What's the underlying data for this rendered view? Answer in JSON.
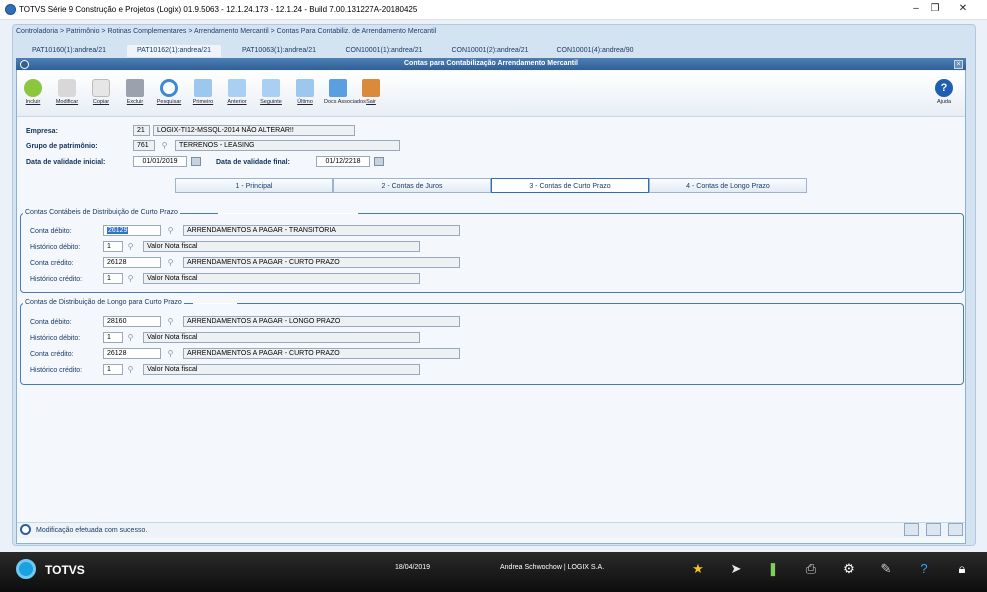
{
  "window": {
    "title": "TOTVS Série 9 Construção e Projetos (Logix) 01.9.5063  -  12.1.24.173 - 12.1.24 - Build 7.00.131227A-20180425"
  },
  "breadcrumb": "Controladoria > Patrimônio > Rotinas Complementares > Arrendamento Mercantil > Contas Para Contabiliz. de Arrendamento Mercantil",
  "top_tabs": [
    "PAT10160(1):andrea/21",
    "PAT10162(1):andrea/21",
    "PAT10063(1):andrea/21",
    "CON10001(1):andrea/21",
    "CON10001(2):andrea/21",
    "CON10001(4):andrea/90"
  ],
  "inner_title": "Contas para Contabilização Arrendamento Mercantil",
  "toolbar": [
    "Incluir",
    "Modificar",
    "Copiar",
    "Excluir",
    "Pesquisar",
    "Primeiro",
    "Anterior",
    "Seguinte",
    "Último",
    "Docs Associados",
    "Sair"
  ],
  "help_label": "Ajuda",
  "header": {
    "empresa_label": "Empresa:",
    "empresa_code": "21",
    "empresa_name": "LOGIX-TI12-MSSQL-2014 NÃO ALTERAR!!",
    "grupo_label": "Grupo de patrimônio:",
    "grupo_code": "761",
    "grupo_name": "TERRENOS - LEASING",
    "data_ini_label": "Data de validade inicial:",
    "data_ini": "01/01/2019",
    "data_fim_label": "Data de validade final:",
    "data_fim": "01/12/2218"
  },
  "page_tabs": [
    "1 - Principal",
    "2 - Contas de Juros",
    "3 - Contas de Curto Prazo",
    "4 - Contas de Longo Prazo"
  ],
  "group1": {
    "title": "Contas Contábeis de Distribuição de Curto Prazo",
    "debito_label": "Conta débito:",
    "debito_code": "26129",
    "debito_name": "ARRENDAMENTOS A PAGAR - TRANSITÓRIA",
    "hist_debito_label": "Histórico débito:",
    "hist_debito_code": "1",
    "hist_debito_name": "Valor Nota fiscal",
    "credito_label": "Conta crédito:",
    "credito_code": "26128",
    "credito_name": "ARRENDAMENTOS A PAGAR - CURTO PRAZO",
    "hist_credito_label": "Histórico crédito:",
    "hist_credito_code": "1",
    "hist_credito_name": "Valor Nota fiscal"
  },
  "group2": {
    "title": "Contas de Distribuição de Longo para Curto Prazo",
    "debito_label": "Conta débito:",
    "debito_code": "28160",
    "debito_name": "ARRENDAMENTOS A PAGAR - LONGO PRAZO",
    "hist_debito_label": "Histórico débito:",
    "hist_debito_code": "1",
    "hist_debito_name": "Valor Nota fiscal",
    "credito_label": "Conta crédito:",
    "credito_code": "26128",
    "credito_name": "ARRENDAMENTOS A PAGAR - CURTO PRAZO",
    "hist_credito_label": "Histórico crédito:",
    "hist_credito_code": "1",
    "hist_credito_name": "Valor Nota fiscal"
  },
  "status": "Modificação efetuada com sucesso.",
  "taskbar": {
    "brand": "TOTVS",
    "date": "18/04/2019",
    "user": "Andrea Schwochow | LOGIX S.A."
  }
}
